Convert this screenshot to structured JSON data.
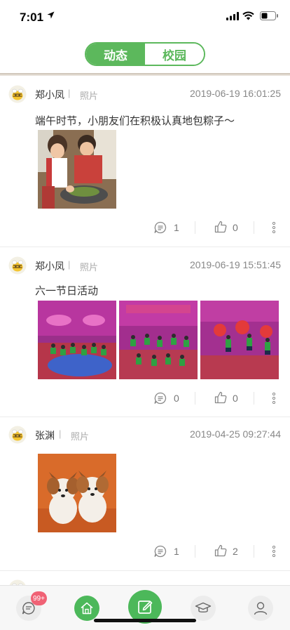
{
  "status": {
    "time": "7:01"
  },
  "tabs": {
    "active": "动态",
    "inactive": "校园"
  },
  "posts": [
    {
      "name": "郑小凤",
      "category": "照片",
      "date": "2019-06-19 16:01:25",
      "text": "端午时节，小朋友们在积极认真地包粽子～",
      "comments": "1",
      "likes": "0"
    },
    {
      "name": "郑小凤",
      "category": "照片",
      "date": "2019-06-19 15:51:45",
      "text": "六一节日活动",
      "comments": "0",
      "likes": "0"
    },
    {
      "name": "张渊",
      "category": "照片",
      "date": "2019-04-25 09:27:44",
      "text": "",
      "comments": "1",
      "likes": "2"
    }
  ],
  "tabbar": {
    "badge": "99+"
  },
  "colors": {
    "accent": "#5cb85c",
    "badge": "#f06275"
  }
}
